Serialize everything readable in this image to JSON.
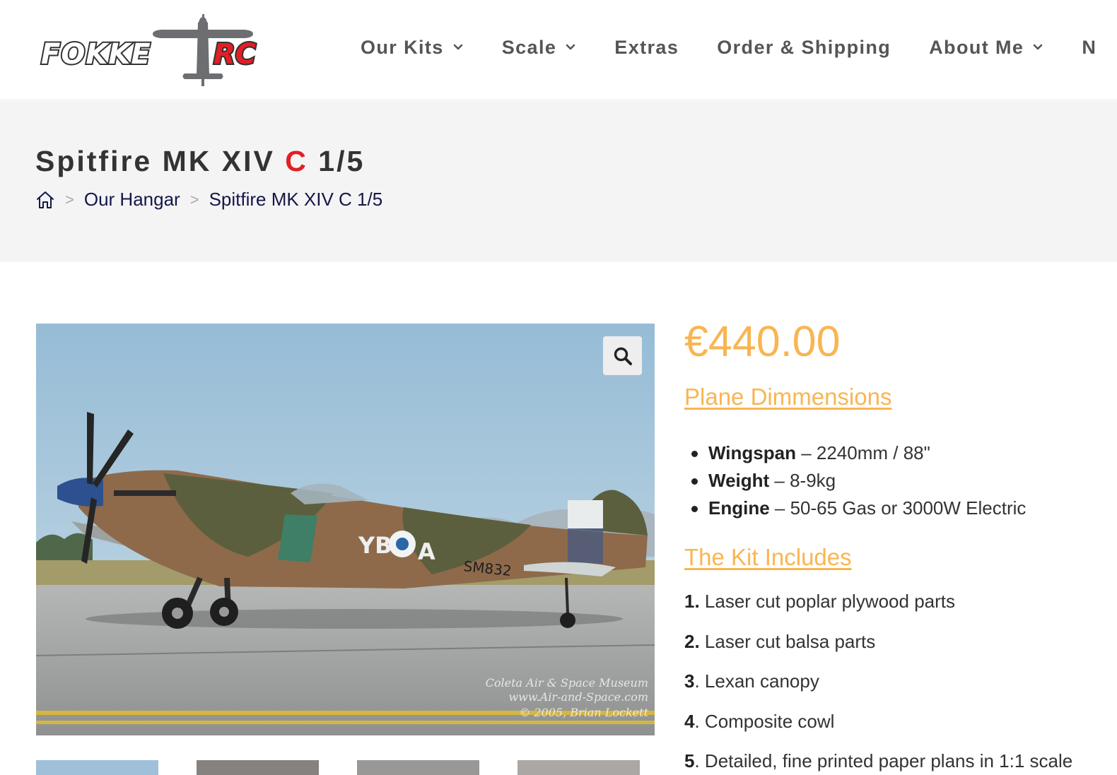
{
  "header": {
    "logo": {
      "brand_left": "FOKKE",
      "brand_right": "RC"
    },
    "nav": [
      {
        "label": "Our Kits",
        "has_dropdown": true
      },
      {
        "label": "Scale",
        "has_dropdown": true
      },
      {
        "label": "Extras",
        "has_dropdown": false
      },
      {
        "label": "Order & Shipping",
        "has_dropdown": false
      },
      {
        "label": "About Me",
        "has_dropdown": true
      },
      {
        "label": "N",
        "has_dropdown": false
      }
    ]
  },
  "title_band": {
    "title_part1": "Spitfire MK XIV ",
    "title_part2": "C",
    "title_part3": " 1/5",
    "breadcrumb": {
      "home_icon": "home-icon",
      "separator": ">",
      "items": [
        "Our Hangar",
        "Spitfire MK XIV C 1/5"
      ]
    }
  },
  "product": {
    "image": {
      "codes": "YB",
      "code_right": "A",
      "serial": "SM832",
      "watermark_line1": "Coleta Air & Space Museum",
      "watermark_line2": "www.Air-and-Space.com",
      "watermark_line3": "© 2005, Brian Lockett"
    },
    "zoom_icon": "magnifier-icon",
    "price": "€440.00",
    "dimensions_heading": "Plane Dimmensions",
    "dimensions": [
      {
        "label": "Wingspan",
        "value": " – 2240mm / 88\""
      },
      {
        "label": "Weight",
        "value": " – 8-9kg"
      },
      {
        "label": "Engine",
        "value": " – 50-65 Gas or 3000W Electric"
      }
    ],
    "kit_heading": "The Kit Includes",
    "kit_items": [
      {
        "num": "1.",
        "text": " Laser cut poplar plywood parts"
      },
      {
        "num": "2.",
        "text": " Laser cut balsa parts"
      },
      {
        "num": "3",
        "text": ". Lexan canopy"
      },
      {
        "num": "4",
        "text": ". Composite cowl"
      },
      {
        "num": "5",
        "text": ". Detailed, fine printed paper plans in 1:1 scale"
      }
    ]
  },
  "colors": {
    "accent": "#f9b552",
    "brand_red": "#e31e24",
    "nav_text": "#555555",
    "breadcrumb": "#13174a"
  }
}
